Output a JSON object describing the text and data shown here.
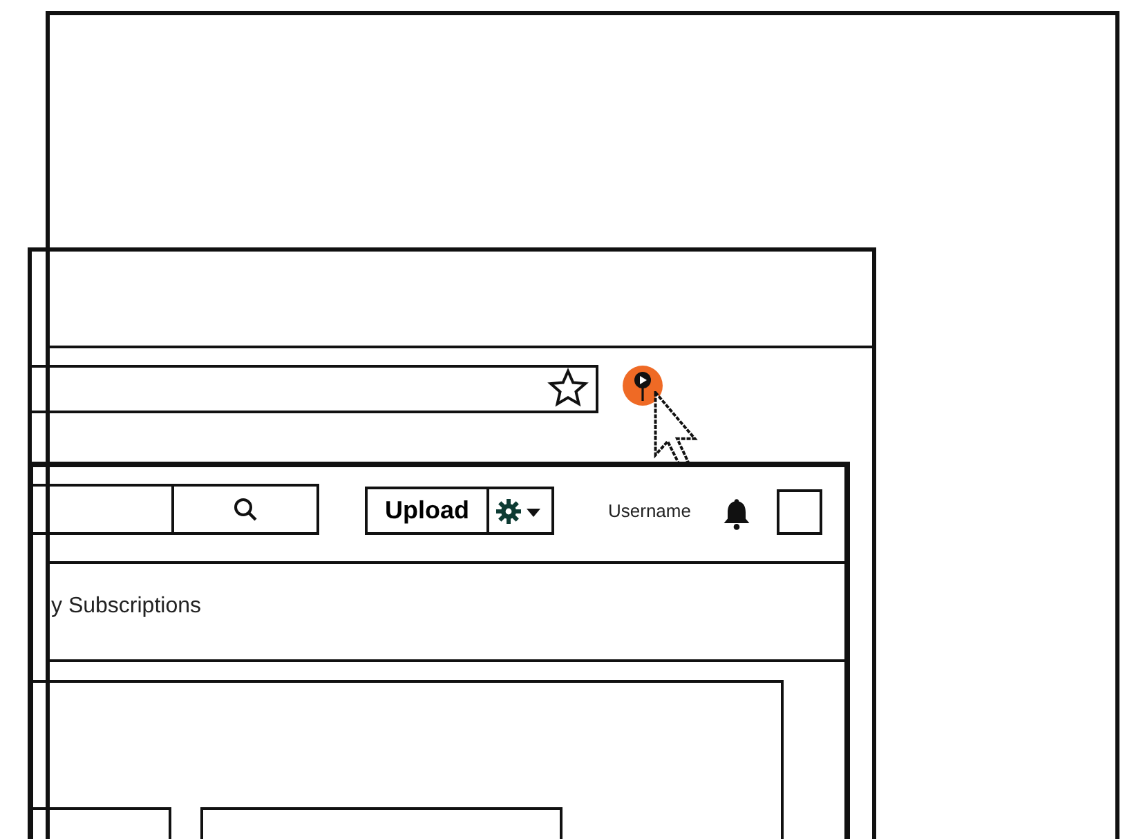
{
  "header": {
    "upload_button": "Upload",
    "username": "Username"
  },
  "nav": {
    "items": [
      {
        "label": "y Subscriptions"
      }
    ]
  }
}
